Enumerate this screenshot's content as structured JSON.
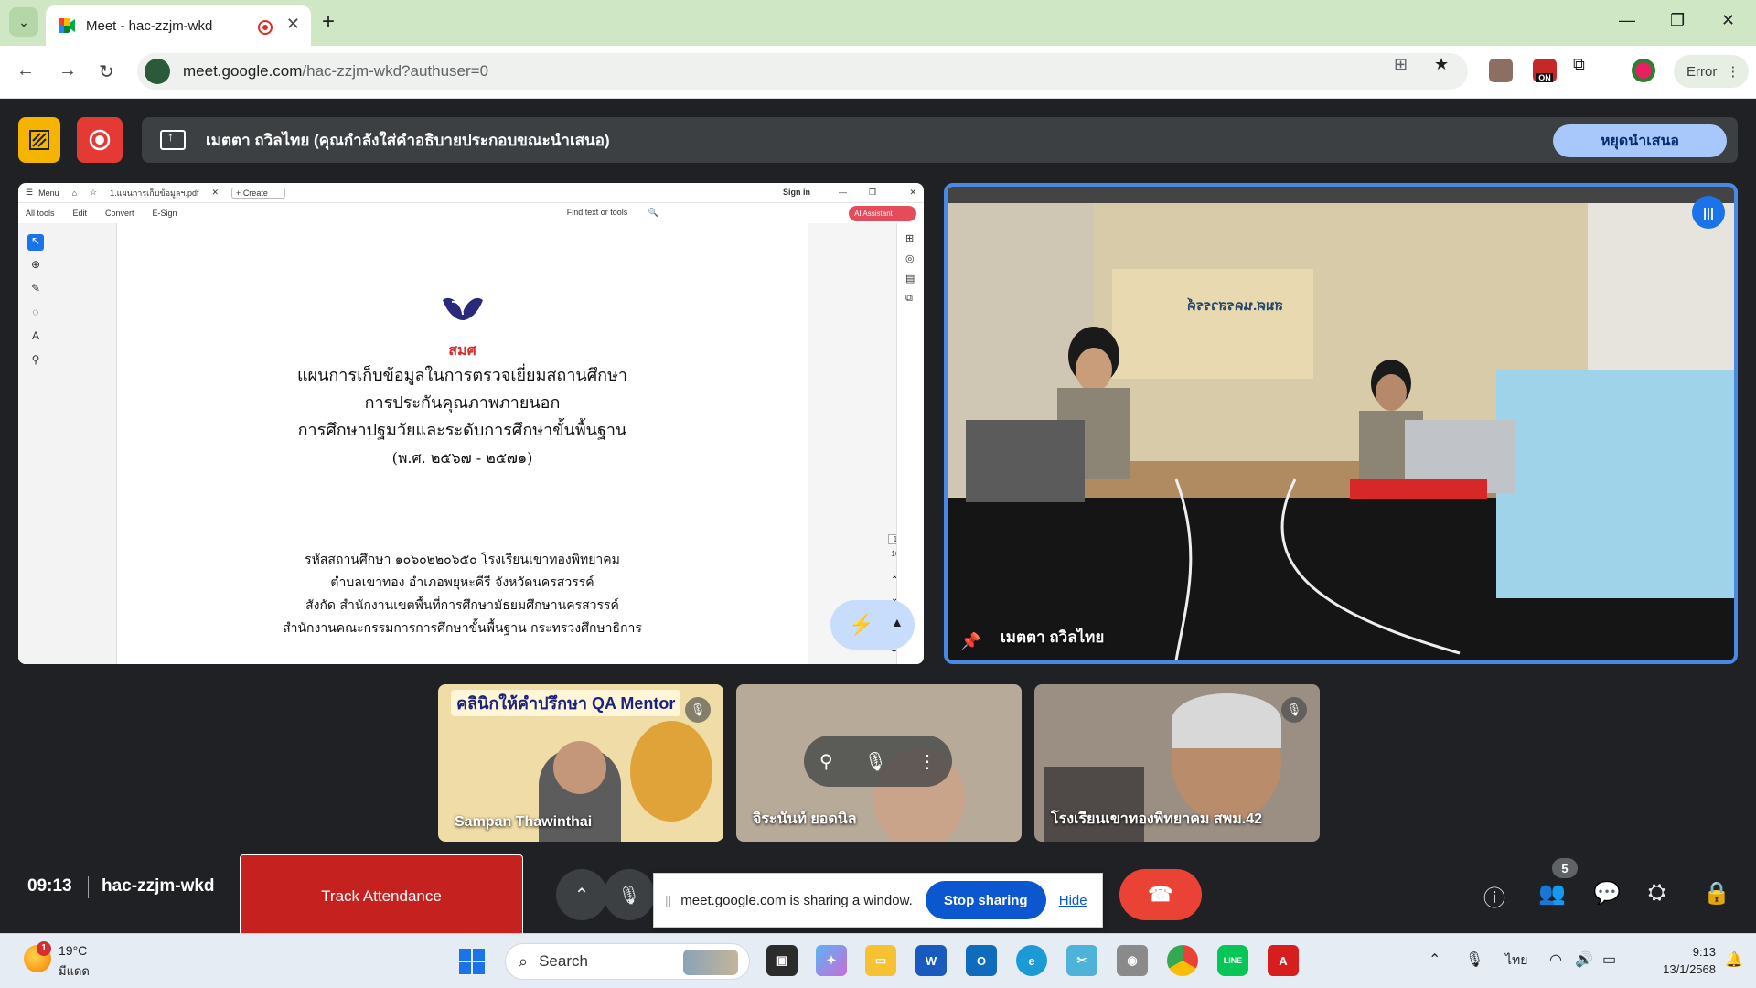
{
  "browser": {
    "tab_title": "Meet - hac-zzjm-wkd",
    "url_host": "meet.google.com",
    "url_path": "/hac-zzjm-wkd?authuser=0",
    "profile_status": "Error",
    "ext_badge": "ON"
  },
  "presenting_bar": {
    "text": "เมตตา ถวิลไทย (คุณกำลังใส่คำอธิบายประกอบขณะนำเสนอ)",
    "stop_label": "หยุดนำเสนอ"
  },
  "shared_doc": {
    "app_menu": "Menu",
    "file_name": "1.แผนการเก็บข้อมูลฯ.pdf",
    "create_label": "Create",
    "sign_in": "Sign in",
    "menu_items": [
      "All tools",
      "Edit",
      "Convert",
      "E-Sign"
    ],
    "find_label": "Find text or tools",
    "ai_label": "AI Assistant",
    "logo_text": "สมศ",
    "title_lines": [
      "แผนการเก็บข้อมูลในการตรวจเยี่ยมสถานศึกษา",
      "การประกันคุณภาพภายนอก",
      "การศึกษาปฐมวัยและระดับการศึกษาขั้นพื้นฐาน",
      "(พ.ศ. ๒๕๖๗ - ๒๕๗๑)"
    ],
    "body_lines": [
      "รหัสสถานศึกษา ๑๐๖๐๒๒๐๖๕๐ โรงเรียนเขาทองพิทยาคม",
      "ตำบลเขาทอง อำเภอพยุหะคีรี จังหวัดนครสวรรค์",
      "สังกัด สำนักงานเขตพื้นที่การศึกษามัธยมศึกษานครสวรรค์",
      "สำนักงานคณะกรรมการการศึกษาขั้นพื้นฐาน กระทรวงศึกษาธิการ"
    ],
    "page_number": "1",
    "page_total": "10"
  },
  "main_speaker": {
    "name": "เมตตา ถวิลไทย",
    "sign_text": "สมศ.นครสวรรค์"
  },
  "participants": [
    {
      "name": "Sampan Thawinthai",
      "banner": "คลินิกให้คำปรึกษา QA Mentor",
      "muted": true
    },
    {
      "name": "จิระนันท์ ยอดนิล",
      "muted": false
    },
    {
      "name": "โรงเรียนเขาทองพิทยาคม สพม.42",
      "muted": true
    }
  ],
  "bottom_bar": {
    "time": "09:13",
    "meeting_code": "hac-zzjm-wkd",
    "track_attendance": "Track Attendance",
    "share_notice": "meet.google.com is sharing a window.",
    "stop_sharing": "Stop sharing",
    "hide": "Hide",
    "people_count": "5"
  },
  "taskbar": {
    "weather_temp": "19°C",
    "weather_cond": "มีแดด",
    "weather_badge": "1",
    "search_label": "Search",
    "lang": "ไทย",
    "time": "9:13",
    "date": "13/1/2568"
  },
  "colors": {
    "meet_bg": "#202124",
    "accent": "#4a88e5",
    "record_red": "#e53935",
    "annotate_yellow": "#f5b400",
    "hangup": "#ea4335"
  }
}
